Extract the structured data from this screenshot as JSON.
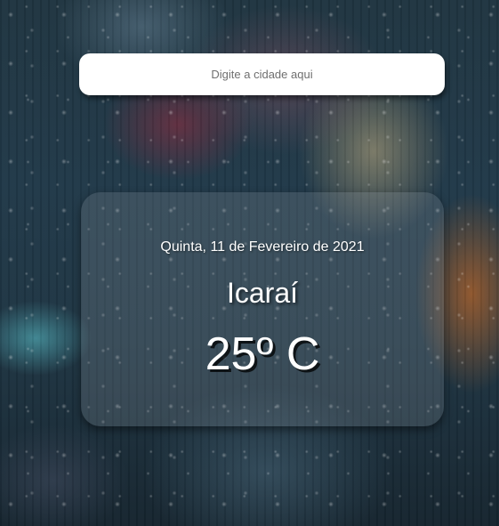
{
  "search": {
    "placeholder": "Digite a cidade aqui",
    "value": ""
  },
  "weather": {
    "date": "Quinta, 11 de Fevereiro de 2021",
    "location": "Icaraí",
    "temperature": "25º C"
  }
}
